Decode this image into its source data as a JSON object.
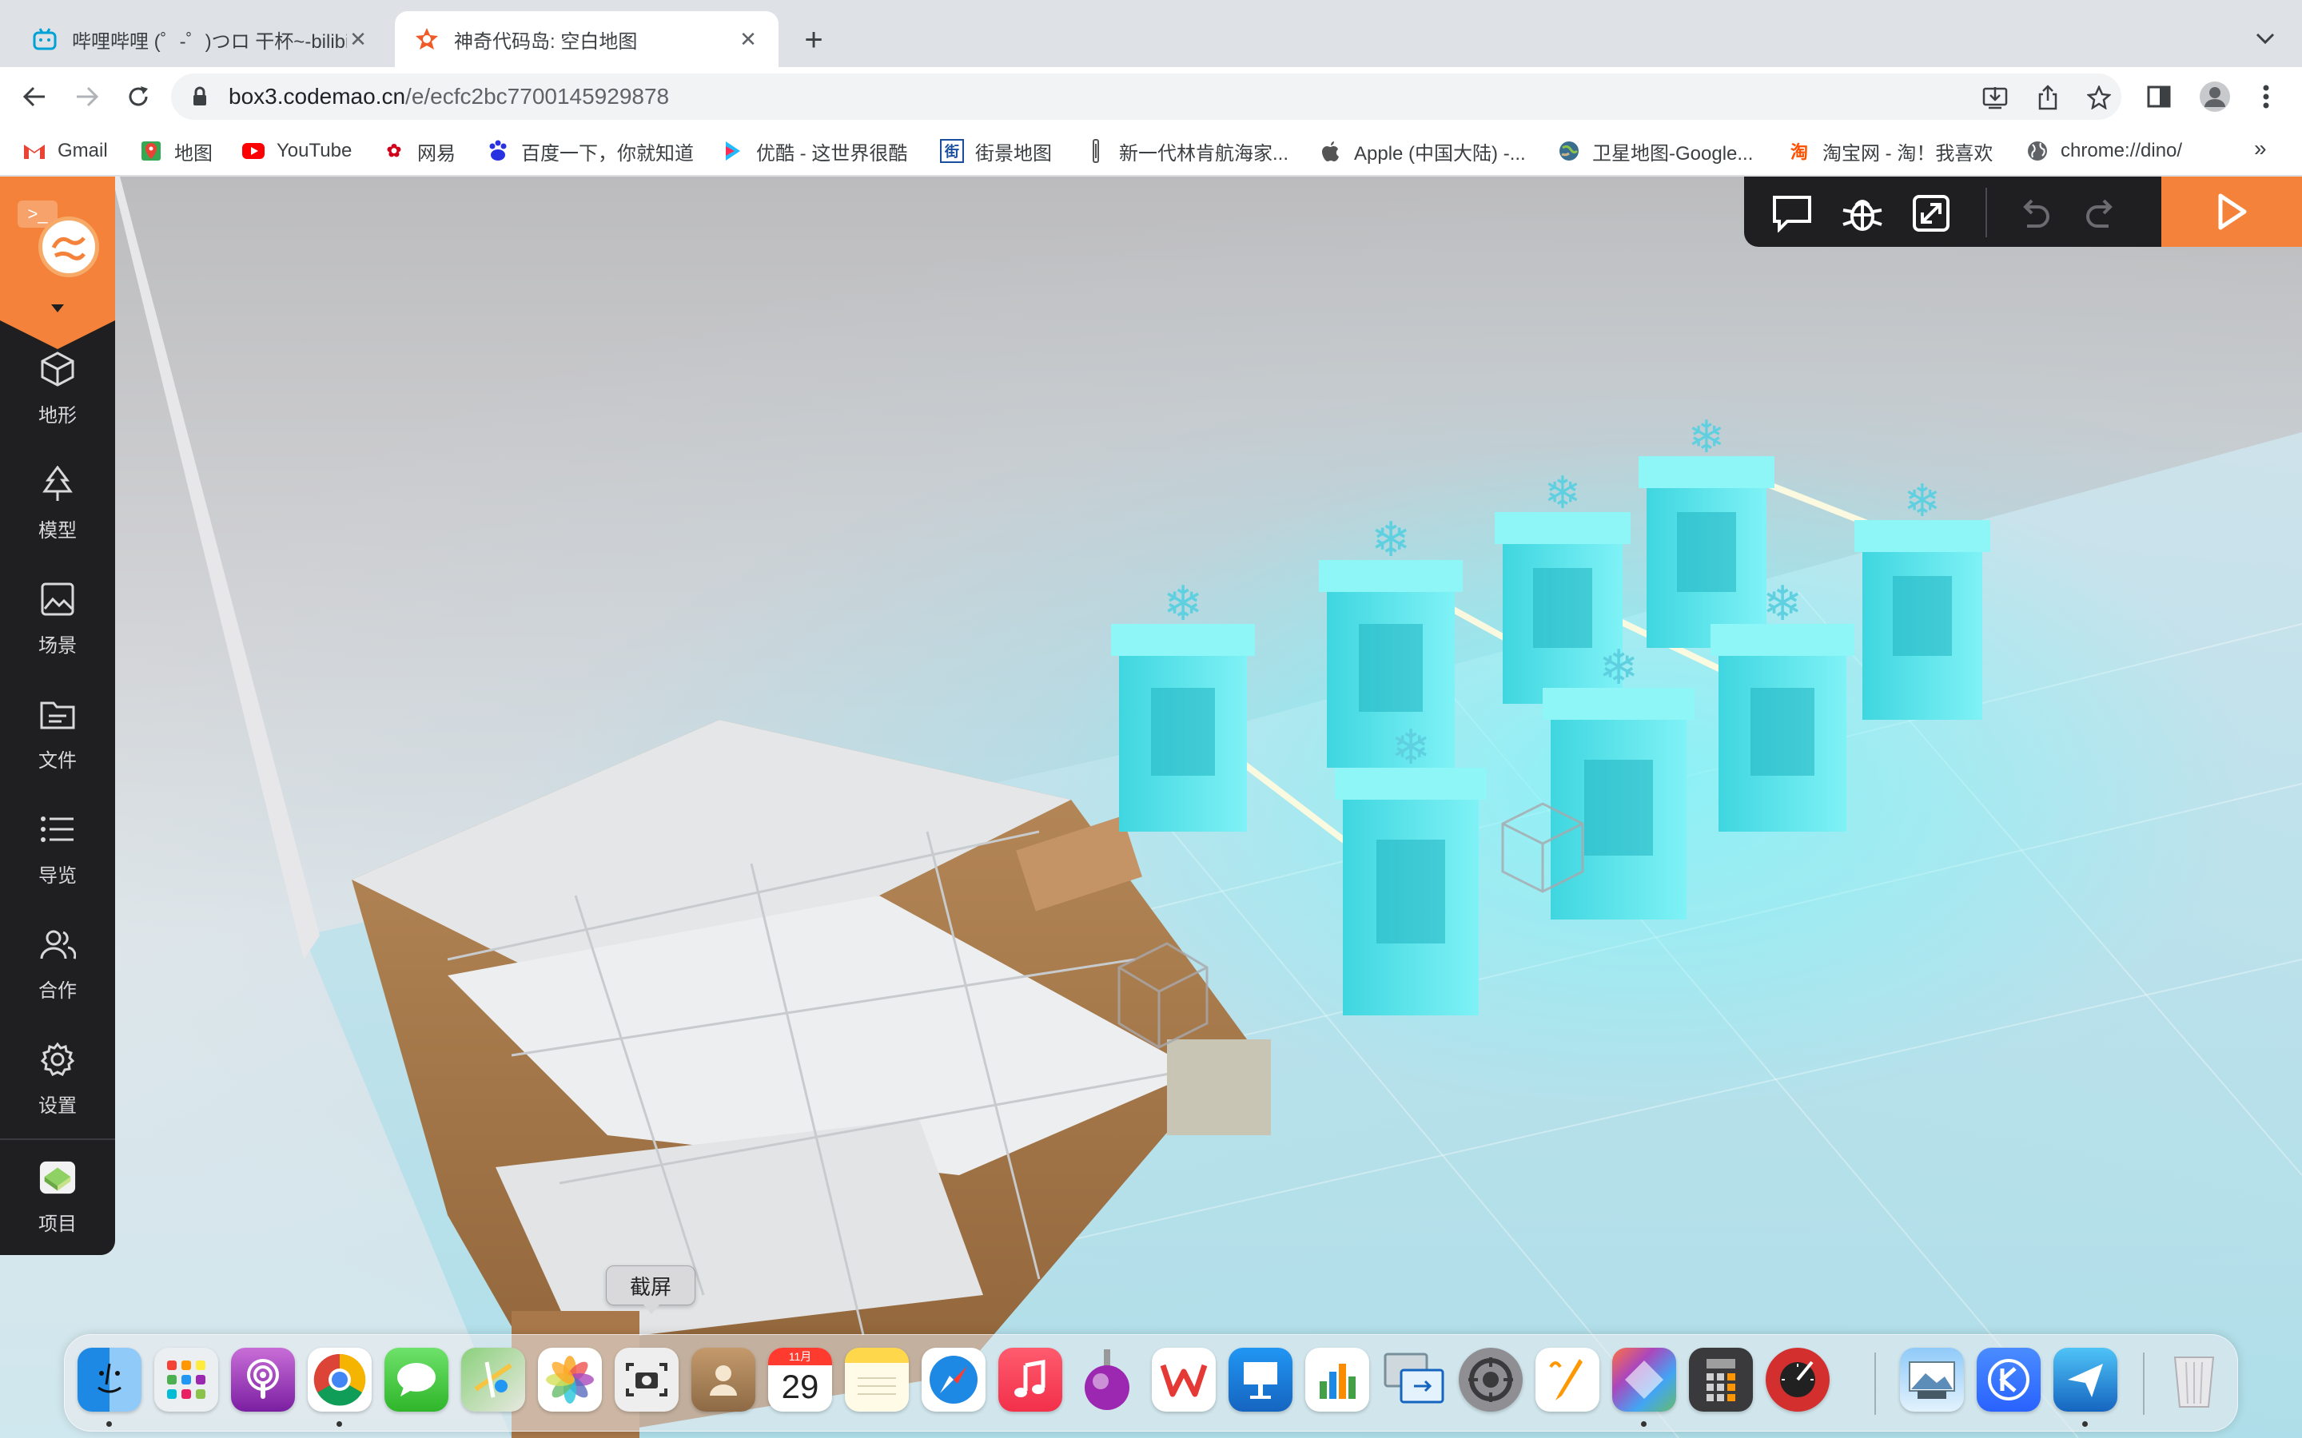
{
  "browser": {
    "tabs": [
      {
        "title": "哔哩哔哩 (゜-゜)つロ 干杯~-bilibili",
        "active": false
      },
      {
        "title": "神奇代码岛: 空白地图",
        "active": true
      }
    ],
    "url_host": "box3.codemao.cn",
    "url_path": "/e/ecfc2bc7700145929878",
    "bookmarks": [
      {
        "label": "Gmail",
        "icon": "gmail-icon"
      },
      {
        "label": "地图",
        "icon": "maps-icon"
      },
      {
        "label": "YouTube",
        "icon": "youtube-icon"
      },
      {
        "label": "网易",
        "icon": "netease-icon"
      },
      {
        "label": "百度一下，你就知道",
        "icon": "baidu-icon"
      },
      {
        "label": "优酷 - 这世界很酷",
        "icon": "youku-icon"
      },
      {
        "label": "街景地图",
        "icon": "streetview-icon"
      },
      {
        "label": "新一代林肯航海家...",
        "icon": "lincoln-icon"
      },
      {
        "label": "Apple (中国大陆) -...",
        "icon": "apple-icon"
      },
      {
        "label": "卫星地图-Google...",
        "icon": "satellite-icon"
      },
      {
        "label": "淘宝网 - 淘！我喜欢",
        "icon": "taobao-icon"
      },
      {
        "label": "chrome://dino/",
        "icon": "globe-icon"
      }
    ],
    "bookmarks_more": "»",
    "taobao_glyph": "淘",
    "streetview_glyph": "街"
  },
  "editor": {
    "sidebar": [
      {
        "label": "地形",
        "icon": "cube-icon"
      },
      {
        "label": "模型",
        "icon": "tree-icon"
      },
      {
        "label": "场景",
        "icon": "image-icon"
      },
      {
        "label": "文件",
        "icon": "folder-icon"
      },
      {
        "label": "导览",
        "icon": "list-icon"
      },
      {
        "label": "合作",
        "icon": "users-icon"
      },
      {
        "label": "设置",
        "icon": "gear-icon"
      },
      {
        "label": "项目",
        "icon": "project-icon"
      }
    ],
    "tooltip": "截屏",
    "colors": {
      "accent": "#f4823a",
      "panel": "#1f1f22",
      "scene_glow": "#5fe8ee"
    }
  },
  "dock": {
    "calendar_month": "11月",
    "calendar_day": "29",
    "apps": [
      "Finder",
      "Launchpad",
      "Podcasts",
      "Chrome",
      "Messages",
      "Maps",
      "Photos",
      "Screenshot",
      "Contacts",
      "Calendar",
      "Notes",
      "Safari",
      "Music",
      "Steuererklärung",
      "WPS",
      "Keynote",
      "Numbers",
      "Screen Sharing",
      "System Preferences",
      "Pages",
      "Pixelmator",
      "Calculator",
      "Instruments",
      "Preview",
      "K",
      "Feishu",
      "Trash"
    ]
  }
}
